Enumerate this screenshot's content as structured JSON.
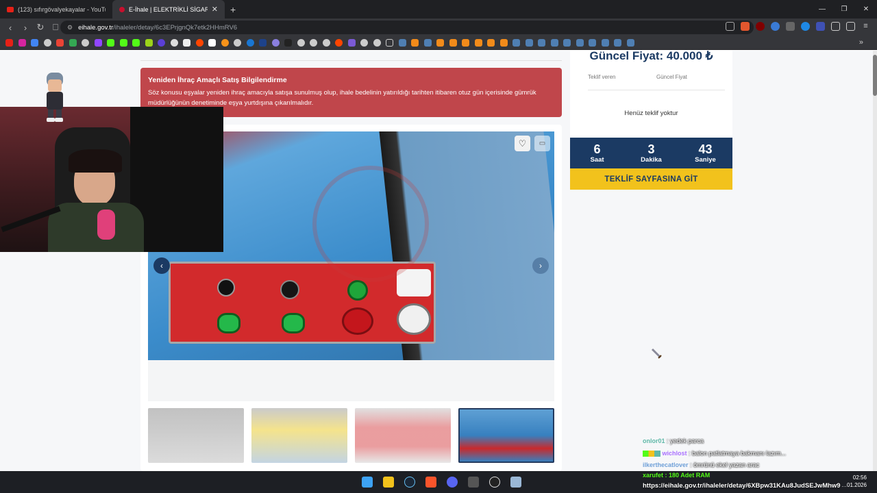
{
  "tabs": [
    {
      "label": "(123) sıfırgövalyekayalar - YouTube",
      "active": false
    },
    {
      "label": "E-İhale | ELEKTRİKLİ SİGARA SAR",
      "active": true
    }
  ],
  "address": {
    "host": "eihale.gov.tr",
    "path": "/ihaleler/detay/6c3EPrjgnQk7etk2HHmRV6"
  },
  "alert": {
    "title": "Yeniden İhraç Amaçlı Satış Bilgilendirme",
    "body": "Söz konusu eşyalar yeniden ihraç amacıyla satışa sunulmuş olup, ihale bedelinin yatırıldığı tarihten itibaren otuz gün içerisinde gümrük müdürlüğünün denetiminde eşya yurtdışına çıkarılmalıdır."
  },
  "bid_panel": {
    "current_price": "Güncel Fiyat: 40.000 ₺",
    "col_bidder": "Teklif veren",
    "col_price": "Güncel Fiyat",
    "empty": "Henüz teklif yoktur",
    "countdown": [
      {
        "value": "6",
        "unit": "Saat"
      },
      {
        "value": "3",
        "unit": "Dakika"
      },
      {
        "value": "43",
        "unit": "Saniye"
      }
    ],
    "cta": "TEKLİF SAYFASINA GİT"
  },
  "chat": [
    {
      "user": "onlor01",
      "msg": ": yedek parca",
      "color": "#5fb8a8"
    },
    {
      "user": "wichlost",
      "msg": ": balon patlatmaya bakmanı lazım...",
      "color": "#a970ff"
    },
    {
      "user": "ilkerthecatlover",
      "msg": ": ömrünü ekel yazan arac",
      "color": "#6fa0d8"
    }
  ],
  "overlay": {
    "top_line": "xarufet : 180 Adet RAM",
    "url_line": "https://eihale.gov.tr/ihaleler/detay/6XBpw31KAu8JudSEJwMhw9"
  },
  "clock": {
    "time": "02:56",
    "date": "…01.2026"
  },
  "colors": {
    "navy": "#1b3a63",
    "yellow": "#f2c21c",
    "alert": "#c0464b"
  }
}
